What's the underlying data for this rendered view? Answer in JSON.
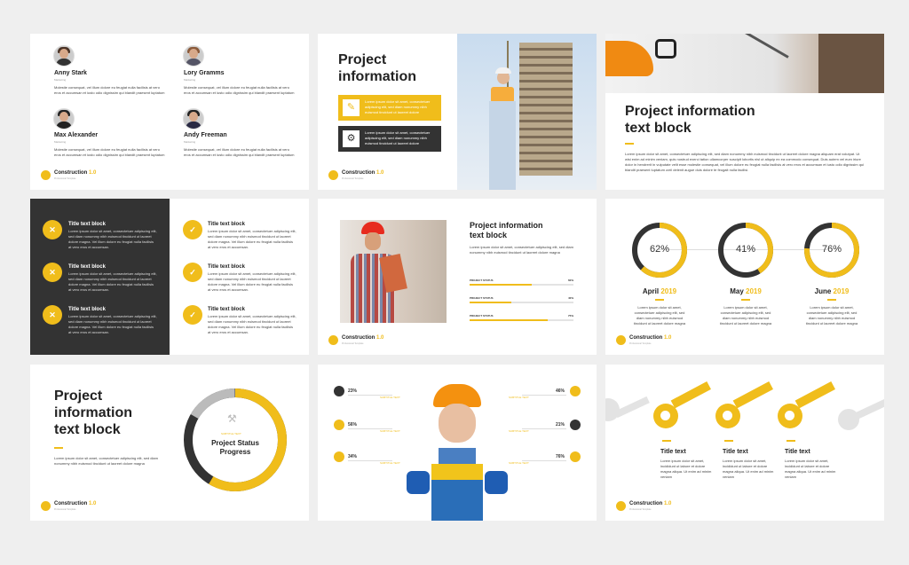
{
  "colors": {
    "accent": "#f0bd1b",
    "dark": "#333333"
  },
  "brand": {
    "name": "Construction",
    "version": "1.0",
    "tagline": "Professional Template"
  },
  "lorem_short": "Molestie consequat, vel illum dolore eu feugiat nulla facilisis at vero eros et accumsan et iusto odio dignissim qui blandit praesent luptatum",
  "lorem_long": "Lorem ipsum dolor sit amet, consectetuer adipiscing elit, sed diam nonummy nibh euismod tincidunt ut laoreet dolore magna aliquam erat volutpat. Ut wisi enim ad minim veniam, quis nostrud exerci tation ullamcorper suscipit lobortis nisl ut aliquip ex ea commodo consequat. Duis autem vel eum iriure dolor in hendrerit in vulputate velit esse molestie consequat, vel illum dolore eu feugiat nulla facilisis at vero eros et accumsan et iusto odio dignissim qui blandit praesent luptatum zzril delenit augue duis dolore te feugait nulla facilisi.",
  "lorem_card": "Lorem ipsum dolor sit amet, consectetuer adipiscing elit, sed diam nonummy nibh euismod tincidunt ut laoreet dolore magna",
  "lorem_col": "Lorem ipsum dolor sit amet, consectetuer adipiscing elit, sed diam nonummy nibh euismod tincidunt ut laoreet dolore magna",
  "team": [
    {
      "name": "Anny Stark",
      "role": "Marketing"
    },
    {
      "name": "Lory Gramms",
      "role": "Marketing"
    },
    {
      "name": "Max Alexander",
      "role": "Marketing"
    },
    {
      "name": "Andy Freeman",
      "role": "Marketing"
    }
  ],
  "s2": {
    "title_1": "Project",
    "title_2": "information",
    "box1": "Lorem ipsum dolor sit amet, consectetuer adipiscing elit, sed diam nonummy nibh euismod tincidunt ut laoreet dolore",
    "box2": "Lorem ipsum dolor sit amet, consectetuer adipiscing elit, sed diam nonummy nibh euismod tincidunt ut laoreet dolore"
  },
  "s3": {
    "title_1": "Project information",
    "title_2": "text block"
  },
  "s4": {
    "item_title": "Title text block",
    "item_text": "Lorem ipsum dolor sit amet, consectetuer adipiscing elit, sed diam nonummy nibh euismod tincidunt ut laoreet dolore magna. Vel illum dolore eu feugiat nulla facilisis at vero eros et accumsan."
  },
  "s5": {
    "title_1": "Project information",
    "title_2": "text block",
    "bars": [
      {
        "label": "PROJECT STATUS",
        "value": 0.6,
        "pct": "60%"
      },
      {
        "label": "PROJECT STATUS",
        "value": 0.4,
        "pct": "40%"
      },
      {
        "label": "PROJECT STATUS",
        "value": 0.75,
        "pct": "75%"
      }
    ]
  },
  "s6": {
    "items": [
      {
        "pct": "62%",
        "month": "April",
        "year": "2019",
        "value": 0.62
      },
      {
        "pct": "41%",
        "month": "May",
        "year": "2019",
        "value": 0.41
      },
      {
        "pct": "76%",
        "month": "June",
        "year": "2019",
        "value": 0.76
      }
    ]
  },
  "s7": {
    "t1": "Project",
    "t2": "information",
    "t3": "text block",
    "sub": "SUBTITLE TEXT",
    "center_1": "Project Status",
    "center_2": "Progress"
  },
  "s8": {
    "left": [
      {
        "pct": "23%",
        "label": "SUBTITLE TEXT"
      },
      {
        "pct": "56%",
        "label": "SUBTITLE TEXT"
      },
      {
        "pct": "34%",
        "label": "SUBTITLE TEXT"
      }
    ],
    "right": [
      {
        "pct": "46%",
        "label": "SUBTITLE TEXT"
      },
      {
        "pct": "21%",
        "label": "SUBTITLE TEXT"
      },
      {
        "pct": "76%",
        "label": "SUBTITLE TEXT"
      }
    ]
  },
  "s9": {
    "keys": [
      {
        "title": "Title text",
        "tag": "SUBTITLE TEXT"
      },
      {
        "title": "Title text",
        "tag": "SUBTITLE TEXT"
      },
      {
        "title": "Title text",
        "tag": "SUBTITLE TEXT"
      }
    ],
    "text": "Lorem ipsum dolor sit amet, incididunt ut labore et dolore magna aliqua. Ut enim ad minim veniam"
  }
}
